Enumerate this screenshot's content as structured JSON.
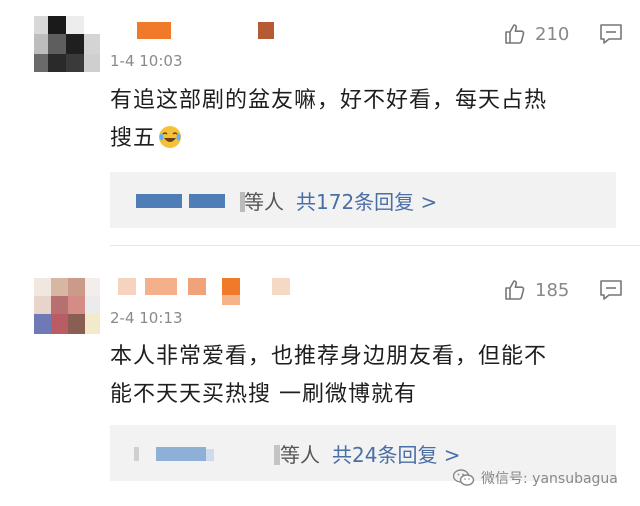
{
  "comments": [
    {
      "time": "1-4 10:03",
      "like_count": "210",
      "text_line1": "有追这部剧的盆友嘛，好不好看，每天占热",
      "text_line2": "搜五",
      "emoji": "crying-laughing-emoji",
      "reply_suffix": "等人",
      "reply_link": "共172条回复 >"
    },
    {
      "time": "2-4 10:13",
      "like_count": "185",
      "text_line1": "本人非常爱看，也推荐身边朋友看，但能不",
      "text_line2": "能不天天买热搜 一刷微博就有",
      "reply_suffix": "等人",
      "reply_link": "共24条回复 >"
    }
  ],
  "watermark": {
    "text": "微信号: yansubagua",
    "icon": "wechat-icon"
  },
  "colors": {
    "link": "#4a6fa5",
    "muted": "#888888",
    "reply_bg": "#f2f2f2",
    "name_orange": "#f07a2a"
  }
}
